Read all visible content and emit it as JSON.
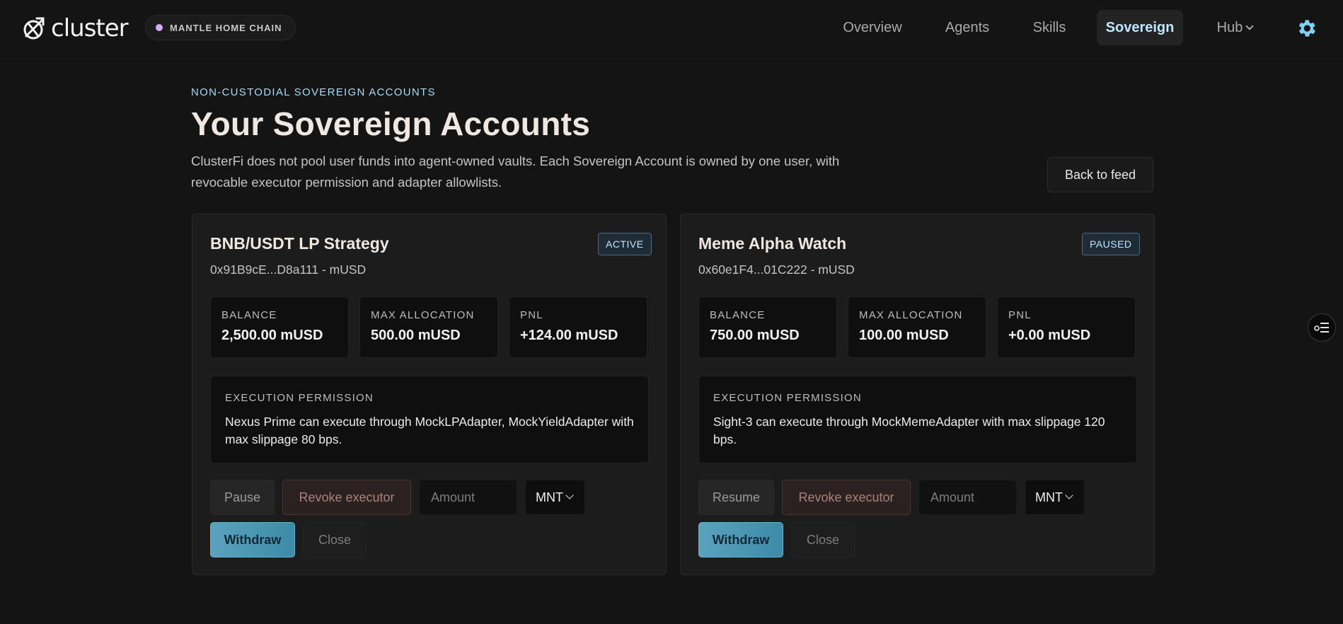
{
  "brand": {
    "name": "cluster",
    "chain_label": "MANTLE HOME CHAIN",
    "chain_dot_color": "#d9a8ee"
  },
  "nav": {
    "items": [
      "Overview",
      "Agents",
      "Skills",
      "Sovereign",
      "Hub"
    ],
    "active": "Sovereign",
    "settings_icon": "gear-icon"
  },
  "header": {
    "eyebrow": "NON-CUSTODIAL SOVEREIGN ACCOUNTS",
    "title": "Your Sovereign Accounts",
    "description": "ClusterFi does not pool user funds into agent-owned vaults. Each Sovereign Account is owned by one user, with revocable executor permission and adapter allowlists.",
    "back_button": "Back to feed"
  },
  "accounts": [
    {
      "name": "BNB/USDT LP Strategy",
      "subtitle": "0x91B9cE...D8a111 - mUSD",
      "status": "ACTIVE",
      "stats": [
        {
          "label": "BALANCE",
          "value": "2,500.00 mUSD"
        },
        {
          "label": "MAX ALLOCATION",
          "value": "500.00 mUSD"
        },
        {
          "label": "PNL",
          "value": "+124.00 mUSD"
        }
      ],
      "permission_label": "EXECUTION PERMISSION",
      "permission_text": "Nexus Prime can execute through MockLPAdapter, MockYieldAdapter with max slippage 80 bps.",
      "toggle_button": "Pause",
      "revoke_button": "Revoke executor",
      "amount_placeholder": "Amount",
      "token": "MNT",
      "withdraw_button": "Withdraw",
      "close_button": "Close"
    },
    {
      "name": "Meme Alpha Watch",
      "subtitle": "0x60e1F4...01C222 - mUSD",
      "status": "PAUSED",
      "stats": [
        {
          "label": "BALANCE",
          "value": "750.00 mUSD"
        },
        {
          "label": "MAX ALLOCATION",
          "value": "100.00 mUSD"
        },
        {
          "label": "PNL",
          "value": "+0.00 mUSD"
        }
      ],
      "permission_label": "EXECUTION PERMISSION",
      "permission_text": "Sight-3 can execute through MockMemeAdapter with max slippage 120 bps.",
      "toggle_button": "Resume",
      "revoke_button": "Revoke executor",
      "amount_placeholder": "Amount",
      "token": "MNT",
      "withdraw_button": "Withdraw",
      "close_button": "Close"
    }
  ],
  "colors": {
    "accent": "#bfe6ff",
    "withdraw": "#4f9bb8",
    "revoke_text": "#a9827c"
  }
}
